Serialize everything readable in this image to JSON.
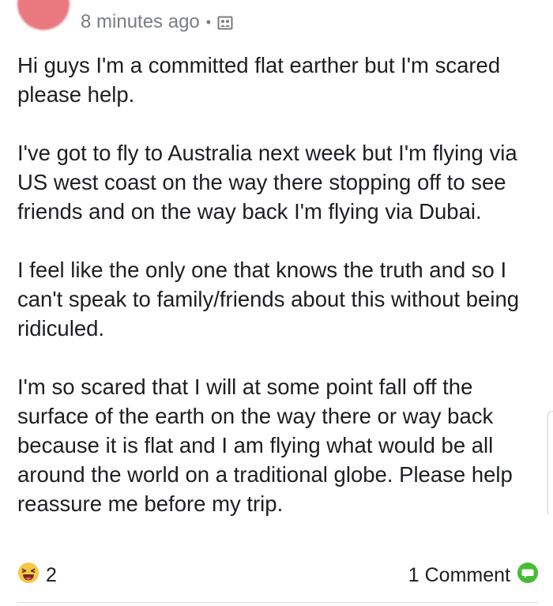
{
  "post": {
    "timestamp": "8 minutes ago",
    "separator": "•",
    "privacy_icon": "group-privacy-icon",
    "paragraphs": [
      "Hi guys I'm a committed flat earther but I'm scared please help.",
      "I've got to fly to Australia next week but I'm flying via US west coast on the way there stopping off to see friends and on the way back I'm flying via Dubai.",
      "I feel like the only one that knows the truth and so I can't speak to family/friends about this without being ridiculed.",
      "I'm so scared that I will at some point fall off the surface of the earth on the way there or way back because it is flat and I am flying what would be all around the world on a traditional globe. Please help reassure me before my trip."
    ]
  },
  "footer": {
    "reaction_icon": "laughing-emoji-icon",
    "reaction_count": "2",
    "comments_label": "1 Comment",
    "comment_icon": "comment-bubble-icon"
  },
  "colors": {
    "text": "#1c1e21",
    "meta": "#7a7d82",
    "comment_icon_green": "#44bd32",
    "emoji_yellow": "#f7c844",
    "avatar": "#e9787f"
  }
}
